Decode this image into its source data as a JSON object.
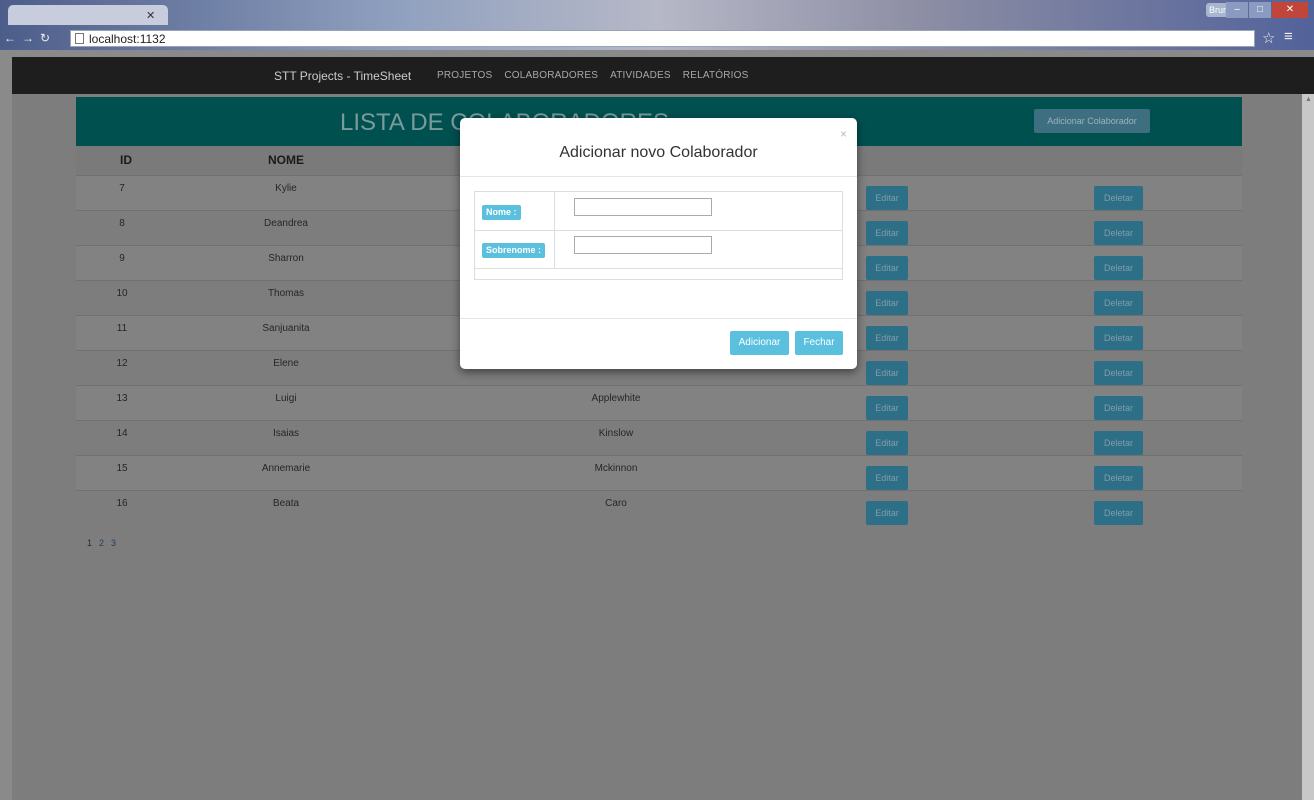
{
  "browser": {
    "url": "localhost:1132",
    "user": "Bruno",
    "icons": {
      "back": "back-arrow-icon",
      "forward": "forward-arrow-icon",
      "refresh": "refresh-icon",
      "page": "page-icon",
      "star": "star-icon",
      "menu": "menu-icon"
    }
  },
  "navbar": {
    "brand": "STT Projects - TimeSheet",
    "items": [
      "PROJETOS",
      "COLABORADORES",
      "ATIVIDADES",
      "RELATÓRIOS"
    ]
  },
  "page": {
    "title": "LISTA DE COLABORADORES",
    "add_button": "Adicionar Colaborador",
    "columns": {
      "id": "ID",
      "nome": "NOME"
    },
    "rows": [
      {
        "id": "7",
        "nome": "Kylie",
        "sobrenome": ""
      },
      {
        "id": "8",
        "nome": "Deandrea",
        "sobrenome": ""
      },
      {
        "id": "9",
        "nome": "Sharron",
        "sobrenome": ""
      },
      {
        "id": "10",
        "nome": "Thomas",
        "sobrenome": ""
      },
      {
        "id": "11",
        "nome": "Sanjuanita",
        "sobrenome": ""
      },
      {
        "id": "12",
        "nome": "Elene",
        "sobrenome": ""
      },
      {
        "id": "13",
        "nome": "Luigi",
        "sobrenome": "Applewhite"
      },
      {
        "id": "14",
        "nome": "Isaias",
        "sobrenome": "Kinslow"
      },
      {
        "id": "15",
        "nome": "Annemarie",
        "sobrenome": "Mckinnon"
      },
      {
        "id": "16",
        "nome": "Beata",
        "sobrenome": "Caro"
      }
    ],
    "edit_label": "Editar",
    "delete_label": "Deletar",
    "pages": [
      "1",
      "2",
      "3"
    ]
  },
  "modal": {
    "title": "Adicionar novo Colaborador",
    "close_symbol": "×",
    "fields": [
      {
        "label": "Nome :",
        "value": ""
      },
      {
        "label": "Sobrenome :",
        "value": ""
      }
    ],
    "submit_label": "Adicionar",
    "close_label": "Fechar"
  }
}
